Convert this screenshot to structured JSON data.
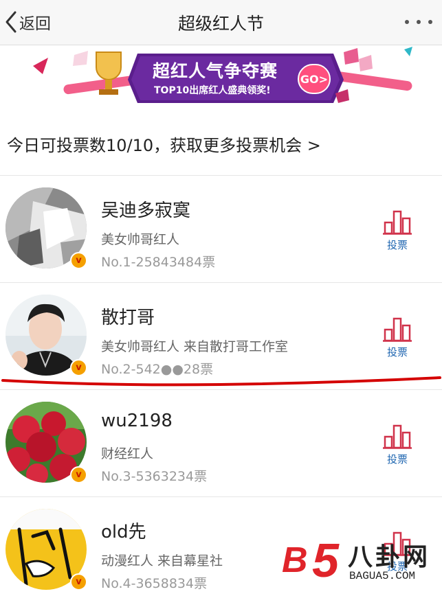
{
  "navbar": {
    "back_label": "返回",
    "title": "超级红人节"
  },
  "banner": {
    "title": "超红人气争夺赛",
    "subtitle": "TOP10出席红人盛典领奖!",
    "go_label": "GO>"
  },
  "vote_info": "今日可投票数10/10，获取更多投票机会 >",
  "list": [
    {
      "name": "吴迪多寂寞",
      "desc": "美女帅哥红人",
      "rank": "No.1-25843484票",
      "vote_label": "投票",
      "badge": "v"
    },
    {
      "name": "散打哥",
      "desc": "美女帅哥红人 来自散打哥工作室",
      "rank": "No.2-542●●28票",
      "vote_label": "投票",
      "badge": "v"
    },
    {
      "name": "wu2198",
      "desc": "财经红人",
      "rank": "No.3-5363234票",
      "vote_label": "投票",
      "badge": "v"
    },
    {
      "name": "old先",
      "desc": "动漫红人 来自幕星社",
      "rank": "No.4-3658834票",
      "vote_label": "投票",
      "badge": "v"
    }
  ],
  "watermark": {
    "b_label": "B",
    "five_label": "5",
    "cn_label": "八卦网",
    "url_label": "BAGUA5.COM"
  },
  "colors": {
    "vote_icon": "#d0324a",
    "vote_text": "#1f66b0",
    "badge": "#f5a000",
    "underline": "#d40000",
    "banner_bg": "#5a1e8c"
  }
}
